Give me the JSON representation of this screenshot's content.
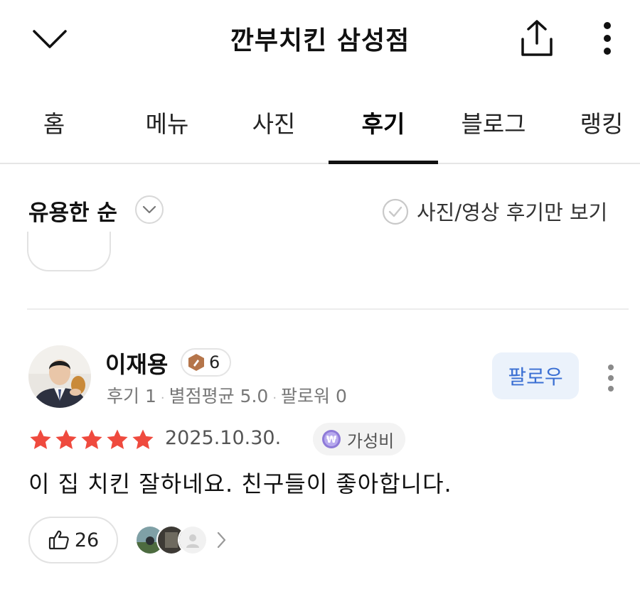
{
  "header": {
    "title": "깐부치킨 삼성점",
    "back_icon": "chevron-down-icon",
    "share_icon": "share-icon",
    "more_icon": "more-vertical-icon"
  },
  "tabs": [
    {
      "label": "홈",
      "active": false
    },
    {
      "label": "메뉴",
      "active": false
    },
    {
      "label": "사진",
      "active": false
    },
    {
      "label": "후기",
      "active": true
    },
    {
      "label": "블로그",
      "active": false
    },
    {
      "label": "랭킹",
      "active": false
    }
  ],
  "filters": {
    "sort_label": "유용한 순",
    "photo_only_label": "사진/영상 후기만 보기",
    "photo_only_checked": false
  },
  "review": {
    "reviewer": {
      "name": "이재용",
      "level": "6",
      "stats": {
        "reviews": "후기 1",
        "avg_rating": "별점평균 5.0",
        "followers": "팔로워 0"
      },
      "follow_label": "팔로우"
    },
    "rating": 5,
    "date": "2025.10.30.",
    "tag": "가성비",
    "text": "이 집 치킨 잘하네요. 친구들이 좋아합니다.",
    "likes": "26"
  },
  "colors": {
    "star": "#ef4a3e",
    "follow_bg": "#ebf2fb",
    "follow_text": "#3a6fd3",
    "badge": "#b5754a"
  }
}
